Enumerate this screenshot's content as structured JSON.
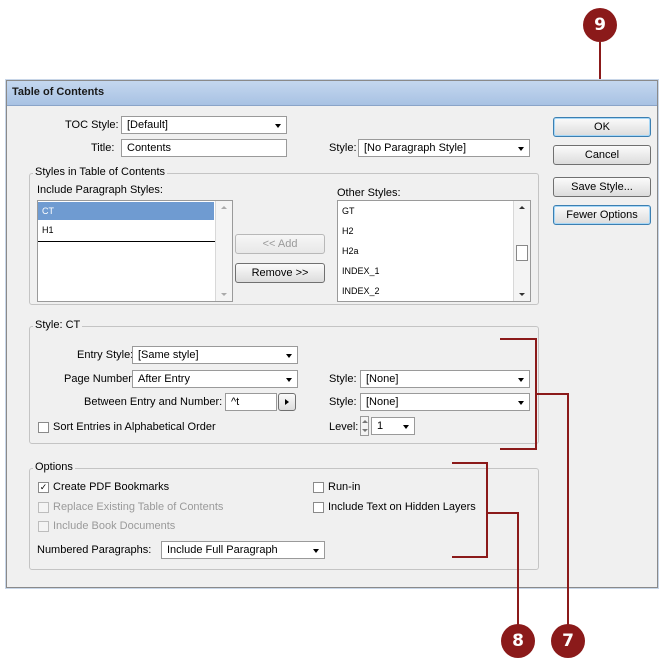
{
  "dialog": {
    "title": "Table of Contents"
  },
  "toc": {
    "toc_style_label": "TOC Style:",
    "toc_style_value": "[Default]",
    "title_label": "Title:",
    "title_value": "Contents",
    "style_label": "Style:",
    "style_value": "[No Paragraph Style]"
  },
  "buttons": {
    "ok": "OK",
    "cancel": "Cancel",
    "save_style": "Save Style...",
    "fewer_options": "Fewer Options",
    "add": "<< Add",
    "remove": "Remove >>"
  },
  "styles_in_toc": {
    "group_title": "Styles in Table of Contents",
    "include_label": "Include Paragraph Styles:",
    "include_items": [
      "CT",
      "H1"
    ],
    "other_label": "Other Styles:",
    "other_items": [
      "GT",
      "H2",
      "H2a",
      "INDEX_1",
      "INDEX_2"
    ]
  },
  "style_ct": {
    "group_title": "Style: CT",
    "entry_style_label": "Entry Style:",
    "entry_style_value": "[Same style]",
    "page_number_label": "Page Number:",
    "page_number_value": "After Entry",
    "page_style_label": "Style:",
    "page_style_value": "[None]",
    "between_label": "Between Entry and Number:",
    "between_value": "^t",
    "between_style_label": "Style:",
    "between_style_value": "[None]",
    "sort_label": "Sort Entries in Alphabetical Order",
    "level_label": "Level:",
    "level_value": "1"
  },
  "options": {
    "group_title": "Options",
    "create_pdf": "Create PDF Bookmarks",
    "replace_existing": "Replace Existing Table of Contents",
    "include_book": "Include Book Documents",
    "run_in": "Run-in",
    "include_hidden": "Include Text on Hidden Layers",
    "numbered_label": "Numbered Paragraphs:",
    "numbered_value": "Include Full Paragraph"
  },
  "callouts": {
    "c9": "9",
    "c8": "8",
    "c7": "7"
  },
  "colors": {
    "callout": "#8b1a1a",
    "selection": "#6f9bd1"
  }
}
